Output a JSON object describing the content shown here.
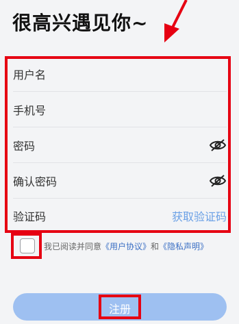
{
  "title": "很高兴遇见你~",
  "fields": [
    {
      "placeholder": "用户名"
    },
    {
      "placeholder": "手机号"
    },
    {
      "placeholder": "密码",
      "icon": "eye-off-icon"
    },
    {
      "placeholder": "确认密码",
      "icon": "eye-off-icon"
    },
    {
      "placeholder": "验证码",
      "action": "获取验证码"
    }
  ],
  "agreement": {
    "prefix": "我已阅读并同意",
    "user_link": "《用户协议》",
    "and": "和",
    "privacy_link": "《隐私声明》"
  },
  "register_label": "注册",
  "colors": {
    "highlight": "#e60012",
    "link": "#3b6fc4",
    "action": "#6aa0e6",
    "button": "#9ec0f1"
  }
}
